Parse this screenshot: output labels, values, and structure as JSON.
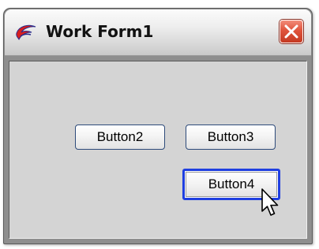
{
  "window": {
    "title": "Work Form1",
    "icon": "app-swoosh-icon",
    "close_icon": "close-icon"
  },
  "buttons": {
    "button2_label": "Button2",
    "button3_label": "Button3",
    "button4_label": "Button4"
  },
  "focus_color": "#1f3fe0",
  "close_color": "#e0543c",
  "cursor": "arrow-pointer-icon"
}
